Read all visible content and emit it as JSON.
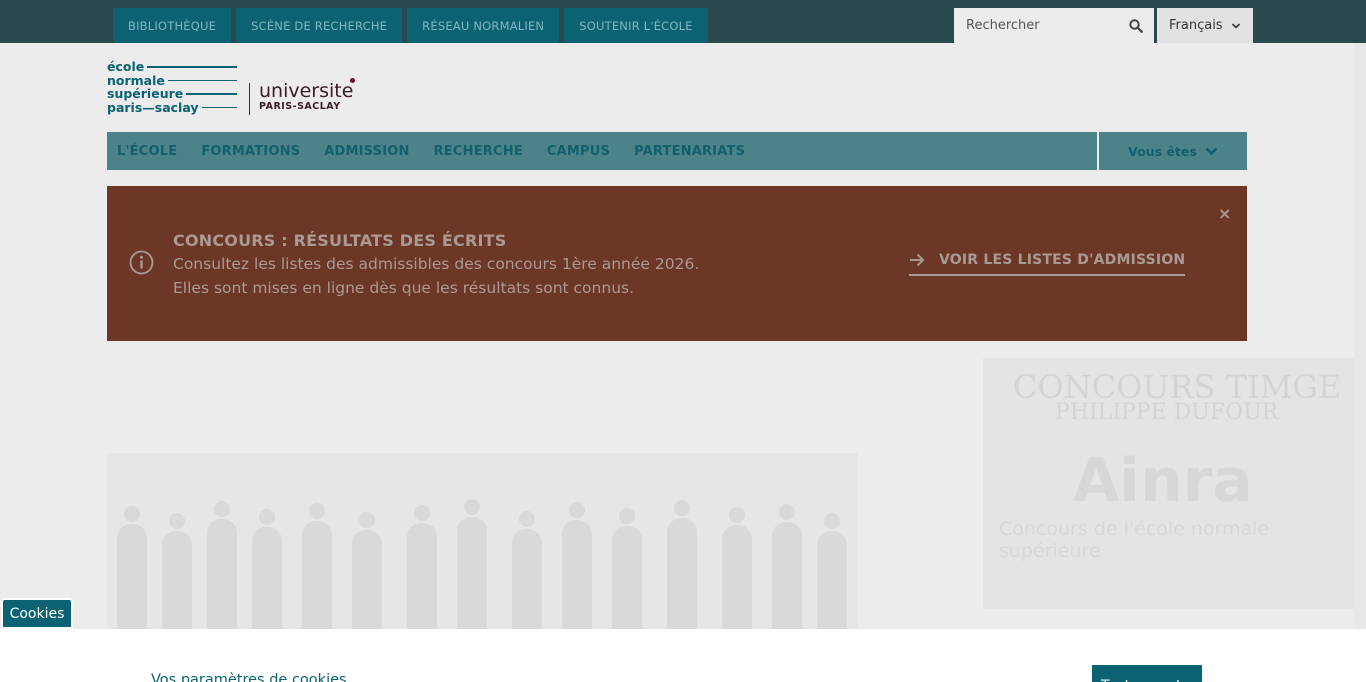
{
  "topbar": {
    "links": [
      "BIBLIOTHÈQUE",
      "SCÈNE DE RECHERCHE",
      "RÉSEAU NORMALIEN",
      "SOUTENIR L'ÉCOLE"
    ],
    "search_placeholder": "Rechercher",
    "language": "Français"
  },
  "logo": {
    "ens_lines": [
      "école",
      "normale",
      "supérieure",
      "paris—saclay"
    ],
    "univ_name": "universite",
    "univ_sub": "PARIS-SACLAY"
  },
  "nav": {
    "items": [
      "L'ÉCOLE",
      "FORMATIONS",
      "ADMISSION",
      "RECHERCHE",
      "CAMPUS",
      "PARTENARIATS"
    ],
    "vous_etes": "Vous êtes"
  },
  "alert": {
    "title": "CONCOURS : RÉSULTATS DES ÉCRITS",
    "line1": "Consultez les listes des admissibles des concours 1ère année 2026.",
    "line2": "Elles sont mises en ligne dès que les résultats sont connus.",
    "link": "VOIR LES LISTES D'ADMISSION",
    "close": "×",
    "accent": "#6d3728"
  },
  "promo": {
    "line1": "CONCOURS TIMGE",
    "line2": "PHILIPPE DUFOUR",
    "brand": "Ainra",
    "line3": "Concours de l'école normale supérieure"
  },
  "cookies": {
    "tab": "Cookies",
    "title": "Vos paramètres de cookies",
    "button": "Tout accepter"
  }
}
